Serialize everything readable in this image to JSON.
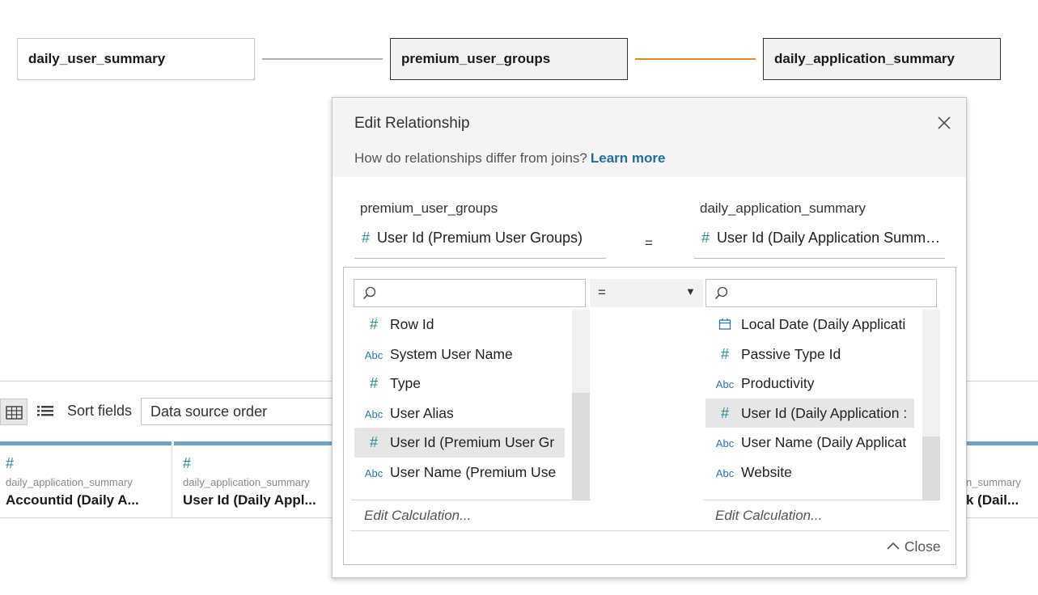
{
  "canvas": {
    "tables": [
      "daily_user_summary",
      "premium_user_groups",
      "daily_application_summary"
    ],
    "connector_colors": [
      "#b0b0b0",
      "#e8872e"
    ]
  },
  "bottom": {
    "sort_label": "Sort fields",
    "sort_value": "Data source order",
    "fields": [
      {
        "icon": "#",
        "source": "daily_application_summary",
        "name": "Accountid (Daily A..."
      },
      {
        "icon": "#",
        "source": "daily_application_summary",
        "name": "User Id (Daily Appl..."
      },
      {
        "icon": "",
        "source": "n_summary",
        "name": "k (Dail..."
      }
    ]
  },
  "dialog": {
    "title": "Edit Relationship",
    "help_text": "How do relationships differ from joins?",
    "learn_more": "Learn more",
    "left_table": "premium_user_groups",
    "right_table": "daily_application_summary",
    "left_field": "User Id (Premium User Groups)",
    "right_field": "User Id (Daily Application Summ…",
    "operator": "=",
    "left_list": [
      {
        "type": "hash",
        "label": "Row Id"
      },
      {
        "type": "abc",
        "label": "System User Name"
      },
      {
        "type": "hash",
        "label": "Type"
      },
      {
        "type": "abc",
        "label": "User Alias"
      },
      {
        "type": "hash",
        "label": "User Id (Premium User Gr",
        "selected": true
      },
      {
        "type": "abc",
        "label": "User Name (Premium Use"
      }
    ],
    "right_list": [
      {
        "type": "date",
        "label": "Local Date (Daily Applicati"
      },
      {
        "type": "hash",
        "label": "Passive Type Id"
      },
      {
        "type": "abc",
        "label": "Productivity"
      },
      {
        "type": "hash",
        "label": "User Id (Daily Application :",
        "selected": true
      },
      {
        "type": "abc",
        "label": "User Name (Daily Applicat"
      },
      {
        "type": "abc",
        "label": "Website"
      }
    ],
    "edit_calc": "Edit Calculation...",
    "close_label": "Close"
  }
}
